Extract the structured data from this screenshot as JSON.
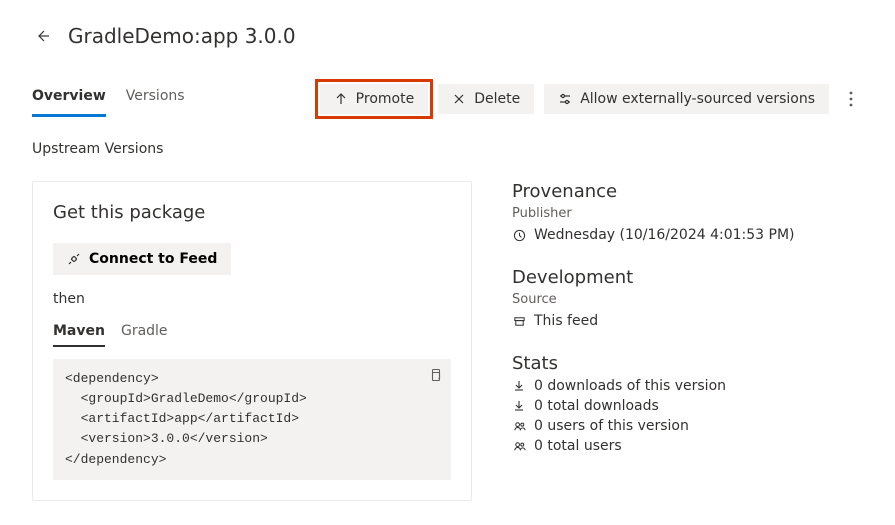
{
  "header": {
    "title": "GradleDemo:app 3.0.0"
  },
  "tabs": {
    "overview": "Overview",
    "versions": "Versions"
  },
  "actions": {
    "promote": "Promote",
    "delete": "Delete",
    "allow_external": "Allow externally-sourced versions"
  },
  "upstream_label": "Upstream Versions",
  "get_package": {
    "title": "Get this package",
    "connect": "Connect to Feed",
    "then": "then",
    "snippet_tabs": {
      "maven": "Maven",
      "gradle": "Gradle"
    },
    "snippet": "<dependency>\n  <groupId>GradleDemo</groupId>\n  <artifactId>app</artifactId>\n  <version>3.0.0</version>\n</dependency>"
  },
  "provenance": {
    "heading": "Provenance",
    "publisher_label": "Publisher",
    "timestamp": "Wednesday (10/16/2024 4:01:53 PM)"
  },
  "development": {
    "heading": "Development",
    "source_label": "Source",
    "source_value": "This feed"
  },
  "stats": {
    "heading": "Stats",
    "line1": "0 downloads of this version",
    "line2": "0 total downloads",
    "line3": "0 users of this version",
    "line4": "0 total users"
  }
}
